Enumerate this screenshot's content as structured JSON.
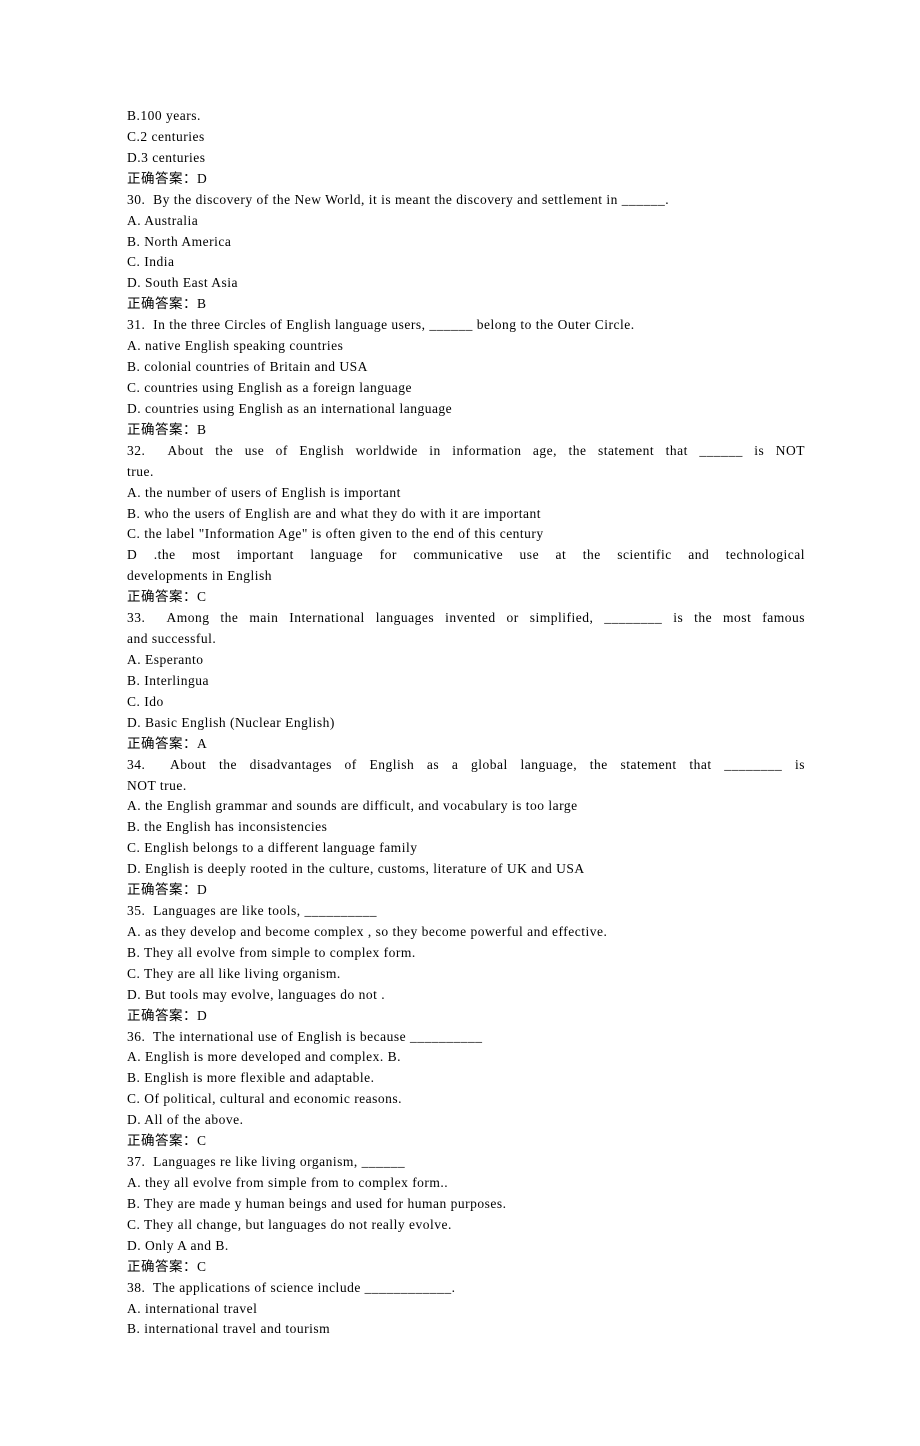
{
  "lines": [
    {
      "text": "B.100 years.",
      "justify": false
    },
    {
      "text": "C.2 centuries",
      "justify": false
    },
    {
      "text": "D.3 centuries",
      "justify": false
    },
    {
      "text": "正确答案：D",
      "justify": false,
      "answer": true
    },
    {
      "text": "30.  By the discovery of the New World, it is meant the discovery and settlement in ______.",
      "justify": false
    },
    {
      "text": "A. Australia",
      "justify": false
    },
    {
      "text": "B. North America",
      "justify": false
    },
    {
      "text": "C. India",
      "justify": false
    },
    {
      "text": "D. South East Asia",
      "justify": false
    },
    {
      "text": "正确答案：B",
      "justify": false,
      "answer": true
    },
    {
      "text": "31.  In the three Circles of English language users, ______ belong to the Outer Circle.",
      "justify": false
    },
    {
      "text": "A. native English speaking countries",
      "justify": false
    },
    {
      "text": "B. colonial countries of Britain and USA",
      "justify": false
    },
    {
      "text": "C. countries using English as a foreign language",
      "justify": false
    },
    {
      "text": "D. countries using English as an international language",
      "justify": false
    },
    {
      "text": "正确答案：B",
      "justify": false,
      "answer": true
    },
    {
      "text": "32.  About the use of English worldwide in information age, the statement that ______ is NOT",
      "justify": true
    },
    {
      "text": "true.",
      "justify": false
    },
    {
      "text": "A. the number of users of English is important",
      "justify": false
    },
    {
      "text": "B. who the users of English are and what they do with it are important",
      "justify": false
    },
    {
      "text": "C. the label \"Information Age\" is often given to the end of this century",
      "justify": false
    },
    {
      "text": "D .the most important language for communicative use at the scientific and technological",
      "justify": true
    },
    {
      "text": "developments in English",
      "justify": false
    },
    {
      "text": "正确答案：C",
      "justify": false,
      "answer": true
    },
    {
      "text": "33.  Among the main International languages invented or simplified, ________ is the most famous",
      "justify": true
    },
    {
      "text": "and successful.",
      "justify": false
    },
    {
      "text": "A. Esperanto",
      "justify": false
    },
    {
      "text": "B. Interlingua",
      "justify": false
    },
    {
      "text": "C. Ido",
      "justify": false
    },
    {
      "text": "D. Basic English (Nuclear English)",
      "justify": false
    },
    {
      "text": "正确答案：A",
      "justify": false,
      "answer": true
    },
    {
      "text": "34.  About the disadvantages of English as a global language, the statement that ________ is",
      "justify": true
    },
    {
      "text": "NOT true.",
      "justify": false
    },
    {
      "text": "A. the English grammar and sounds are difficult, and vocabulary is too large",
      "justify": false
    },
    {
      "text": "B. the English has inconsistencies",
      "justify": false
    },
    {
      "text": "C. English belongs to a different language family",
      "justify": false
    },
    {
      "text": "D. English is deeply rooted in the culture, customs, literature of UK and USA",
      "justify": false
    },
    {
      "text": "正确答案：D",
      "justify": false,
      "answer": true
    },
    {
      "text": "35.  Languages are like tools, __________",
      "justify": false
    },
    {
      "text": "A. as they develop and become complex , so they become powerful and effective.",
      "justify": false
    },
    {
      "text": "B. They all evolve from simple to complex form.",
      "justify": false
    },
    {
      "text": "C. They are all like living organism.",
      "justify": false
    },
    {
      "text": "D. But tools may evolve, languages do not .",
      "justify": false
    },
    {
      "text": "正确答案：D",
      "justify": false,
      "answer": true
    },
    {
      "text": "36.  The international use of English is because __________",
      "justify": false
    },
    {
      "text": "A. English is more developed and complex. B.",
      "justify": false
    },
    {
      "text": "B. English is more flexible and adaptable.",
      "justify": false
    },
    {
      "text": "C. Of political, cultural and economic reasons.",
      "justify": false
    },
    {
      "text": "D. All of the above.",
      "justify": false
    },
    {
      "text": "正确答案：C",
      "justify": false,
      "answer": true
    },
    {
      "text": "37.  Languages re like living organism, ______",
      "justify": false
    },
    {
      "text": "A. they all evolve from simple from to complex form..",
      "justify": false
    },
    {
      "text": "B. They are made y human beings and used for human purposes.",
      "justify": false
    },
    {
      "text": "C. They all change, but languages do not really evolve.",
      "justify": false
    },
    {
      "text": "D. Only A and B.",
      "justify": false
    },
    {
      "text": "正确答案：C",
      "justify": false,
      "answer": true
    },
    {
      "text": "38.  The applications of science include ____________.",
      "justify": false
    },
    {
      "text": "A. international travel",
      "justify": false
    },
    {
      "text": "B. international travel and tourism",
      "justify": false
    }
  ]
}
